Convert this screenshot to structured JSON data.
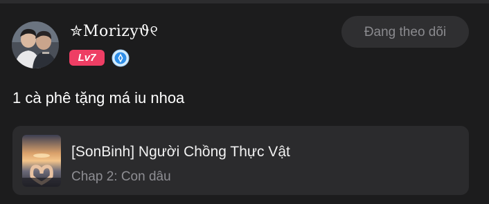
{
  "post": {
    "username": "✮Morizyϑ୧",
    "level": "Lv7",
    "follow_label": "Đang theo dõi",
    "message": "1 cà phê tặng má iu nhoa"
  },
  "manga": {
    "title": "[SonBinh] Người Chồng Thực Vật",
    "chapter": "Chap 2: Con dâu"
  },
  "colors": {
    "background": "#1c1c1d",
    "card": "#2b2b2d",
    "level_badge": "#ee3e64",
    "rank_badge": "#2e8ee8",
    "follow_button_bg": "#2f2f31",
    "follow_button_text": "#8a8a8e"
  },
  "icons": {
    "avatar": "user-avatar-photo",
    "rank": "rank-emblem-icon",
    "cover": "manga-cover-image"
  }
}
